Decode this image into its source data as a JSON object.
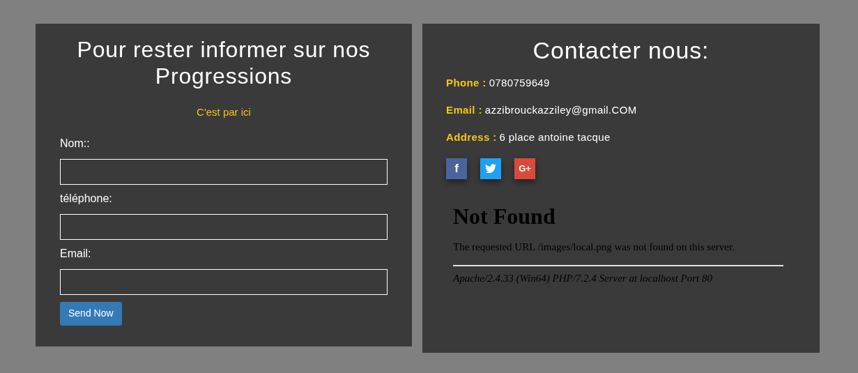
{
  "signup": {
    "title": "Pour rester informer sur nos Progressions",
    "link": "C'est par ici",
    "fields": [
      {
        "label": "Nom::"
      },
      {
        "label": "téléphone:"
      },
      {
        "label": "Email:"
      }
    ],
    "button": "Send Now"
  },
  "contact": {
    "title": "Contacter nous:",
    "items": [
      {
        "label": "Phone :",
        "value": "0780759649"
      },
      {
        "label": "Email :",
        "value": "azzibrouckazziley@gmail.COM"
      },
      {
        "label": "Address :",
        "value": "6 place antoine tacque"
      }
    ],
    "socials": [
      {
        "kind": "facebook",
        "color": "#4a64a0",
        "glyph": "f"
      },
      {
        "kind": "twitter",
        "color": "#1da1f2"
      },
      {
        "kind": "google-plus",
        "color": "#db4a39",
        "glyph": "G+"
      }
    ],
    "error": {
      "heading": "Not Found",
      "message": "The requested URL /images/local.png was not found on this server.",
      "signature": "Apache/2.4.33 (Win64) PHP/7.2.4 Server at localhost Port 80"
    }
  }
}
